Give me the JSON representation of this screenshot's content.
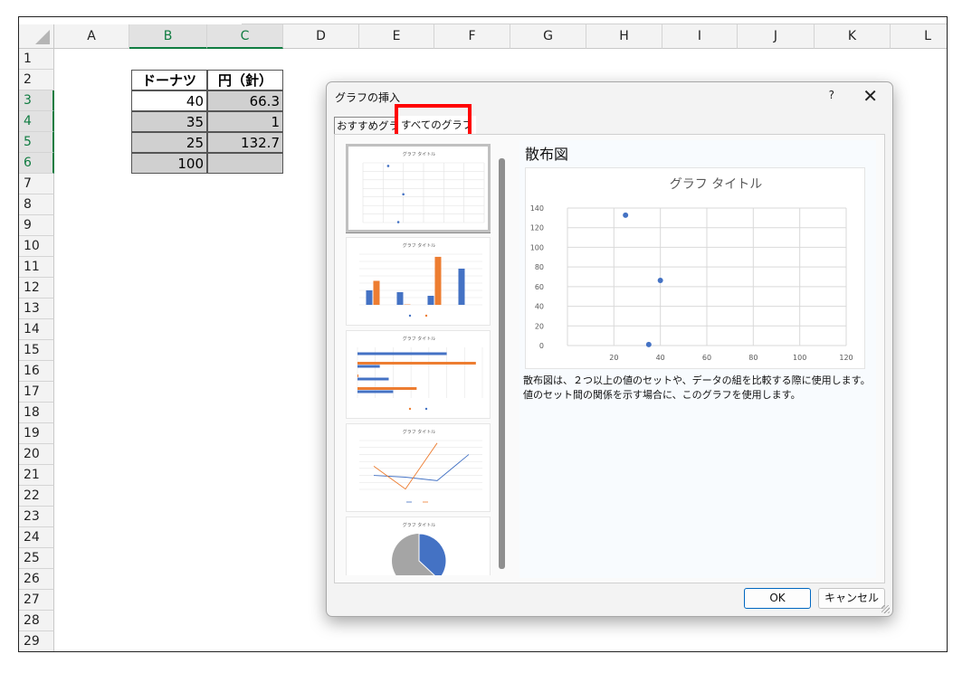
{
  "sheet": {
    "columns": [
      "A",
      "B",
      "C",
      "D",
      "E",
      "F",
      "G",
      "H",
      "I",
      "J",
      "K",
      "L"
    ],
    "rows": [
      "1",
      "2",
      "3",
      "4",
      "5",
      "6",
      "7",
      "8",
      "9",
      "10",
      "11",
      "12",
      "13",
      "14",
      "15",
      "16",
      "17",
      "18",
      "19",
      "20",
      "21",
      "22",
      "23",
      "24",
      "25",
      "26",
      "27",
      "28",
      "29"
    ],
    "selected_columns": [
      "B",
      "C"
    ],
    "selected_rows": [
      "3",
      "4",
      "5",
      "6"
    ],
    "table": {
      "headers": [
        "ドーナツ",
        "円（針）"
      ],
      "rows": [
        [
          "40",
          "66.3"
        ],
        [
          "35",
          "1"
        ],
        [
          "25",
          "132.7"
        ],
        [
          "100",
          ""
        ]
      ]
    }
  },
  "dialog": {
    "title": "グラフの挿入",
    "help": "?",
    "close": "✕",
    "tabs": [
      "おすすめグラフ",
      "すべてのグラフ"
    ],
    "active_tab": "すべてのグラフ",
    "highlight_color": "#ff0000",
    "thumbnails": [
      {
        "type": "scatter",
        "title": "グラフ タイトル"
      },
      {
        "type": "column",
        "title": "グラフ タイトル"
      },
      {
        "type": "bar",
        "title": "グラフ タイトル"
      },
      {
        "type": "line",
        "title": "グラフ タイトル"
      },
      {
        "type": "pie",
        "title": "グラフ タイトル"
      }
    ],
    "preview": {
      "chart_type_name": "散布図",
      "description": "散布図は、２つ以上の値のセットや、データの組を比較する際に使用します。値のセット間の関係を示す場合に、このグラフを使用します。"
    },
    "buttons": {
      "ok": "OK",
      "cancel": "キャンセル"
    }
  },
  "colors": {
    "series1": "#4472c4",
    "series2": "#ed7d31",
    "pie_gray": "#a5a5a5",
    "excel_green": "#107c41",
    "ok_border": "#0067c0"
  },
  "chart_data": [
    {
      "type": "scatter",
      "title": "グラフ タイトル",
      "x": [
        40,
        35,
        25
      ],
      "y": [
        66.3,
        1,
        132.7
      ],
      "xlim": [
        0,
        120
      ],
      "ylim": [
        0,
        140
      ],
      "xticks": [
        20,
        40,
        60,
        80,
        100,
        120
      ],
      "yticks": [
        0,
        20,
        40,
        60,
        80,
        100,
        120,
        140
      ],
      "grid": true
    }
  ]
}
